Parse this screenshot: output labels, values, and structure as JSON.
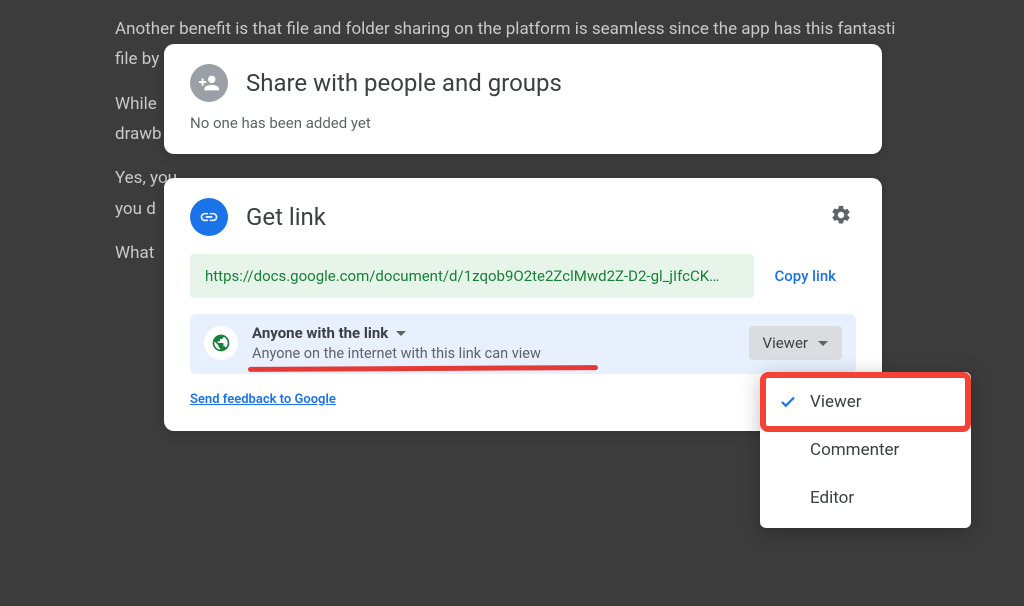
{
  "background_doc": {
    "p1": "Another benefit is that file and folder sharing on the platform is seamless since the app has this fantasti",
    "p1b": "file by",
    "p2": "While",
    "p2b": "drawb",
    "p3": "Yes, you",
    "p3b": "you d",
    "p4": "What"
  },
  "share_card": {
    "title": "Share with people and groups",
    "subtitle": "No one has been added yet"
  },
  "link_card": {
    "title": "Get link",
    "url": "https://docs.google.com/document/d/1zqob9O2te2ZclMwd2Z-D2-gl_jIfcCK…",
    "copy": "Copy link",
    "access_label": "Anyone with the link",
    "access_desc": "Anyone on the internet with this link can view",
    "role_button": "Viewer",
    "feedback": "Send feedback to Google"
  },
  "role_menu": {
    "items": [
      {
        "label": "Viewer",
        "selected": true
      },
      {
        "label": "Commenter",
        "selected": false
      },
      {
        "label": "Editor",
        "selected": false
      }
    ]
  }
}
